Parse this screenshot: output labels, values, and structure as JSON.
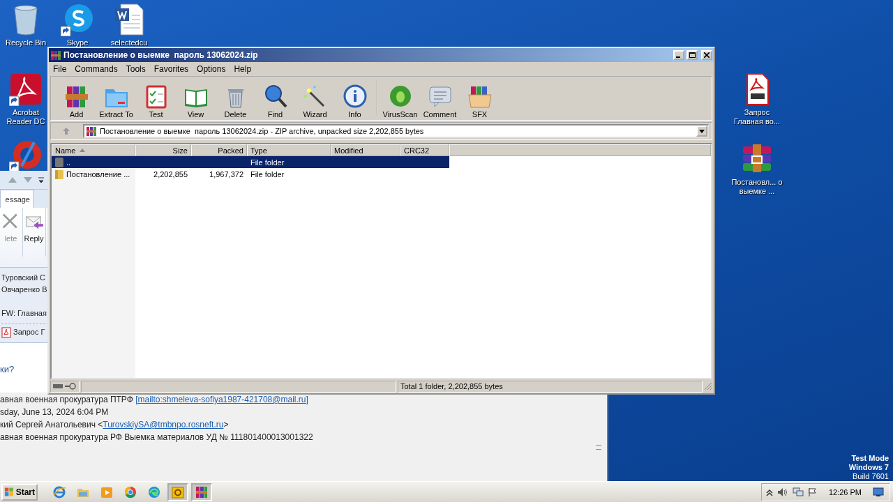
{
  "desktop": {
    "icons": [
      {
        "kind": "recycle",
        "label": "Recycle Bin",
        "shortcut": false
      },
      {
        "kind": "skype",
        "label": "Skype",
        "shortcut": true
      },
      {
        "kind": "word",
        "label": "selectedcu",
        "shortcut": false
      },
      {
        "kind": "acrobat",
        "label": "Acrobat Reader DC",
        "shortcut": true
      },
      {
        "kind": "ccleaner",
        "shortcut": true
      },
      {
        "kind": "pdf",
        "label": "Запрос Главная во...",
        "shortcut": false
      },
      {
        "kind": "rar",
        "label": "Постановл... о выемке  ...",
        "shortcut": false
      }
    ],
    "watermark_lines": [
      "Test Mode",
      "Windows 7",
      "Build 7601"
    ]
  },
  "mail_window": {
    "tabs": [
      {
        "label": "essage",
        "selected": true
      }
    ],
    "ribbon_buttons": [
      {
        "kind": "delete",
        "label": "lete",
        "disabled": true
      },
      {
        "kind": "reply",
        "label": "Reply",
        "disabled": false
      }
    ],
    "recipients": [
      "Туровский С",
      "Овчаренко В"
    ],
    "subject": "FW: Главная",
    "attachment": "Запрос Г",
    "body_text": "ки?",
    "header_lines": [
      {
        "text": "авная военная прокуратура ПТРФ ",
        "link": "[mailto:shmeleva-sofiya1987-421708@mail.ru]"
      },
      {
        "text": "sday, June 13, 2024 6:04 PM"
      },
      {
        "text": "кий Сергей Анатольевич <",
        "link": "TurovskiySA@tmbnpo.rosneft.ru",
        "after": ">"
      },
      {
        "text": "авная военная прокуратура РФ Выемка материалов УД № 111801400013001322"
      }
    ]
  },
  "archiver": {
    "title": "Постановление о выемке  пароль 13062024.zip",
    "menu": [
      "File",
      "Commands",
      "Tools",
      "Favorites",
      "Options",
      "Help"
    ],
    "toolbar": [
      {
        "kind": "add",
        "label": "Add"
      },
      {
        "kind": "extract",
        "label": "Extract To"
      },
      {
        "kind": "test",
        "label": "Test"
      },
      {
        "kind": "view",
        "label": "View"
      },
      {
        "kind": "delete",
        "label": "Delete"
      },
      {
        "kind": "find",
        "label": "Find"
      },
      {
        "kind": "wizard",
        "label": "Wizard"
      },
      {
        "kind": "info",
        "label": "Info"
      },
      {
        "kind": "virus",
        "label": "VirusScan"
      },
      {
        "kind": "comment",
        "label": "Comment"
      },
      {
        "kind": "sfx",
        "label": "SFX"
      }
    ],
    "address": "Постановление о выемке  пароль 13062024.zip - ZIP archive, unpacked size 2,202,855 bytes",
    "columns": [
      {
        "label": "Name",
        "sorted": true
      },
      {
        "label": "Size",
        "sorted": false
      },
      {
        "label": "Packed",
        "sorted": false
      },
      {
        "label": "Type",
        "sorted": false
      },
      {
        "label": "Modified",
        "sorted": false
      },
      {
        "label": "CRC32",
        "sorted": false
      }
    ],
    "rows": [
      {
        "kind": "up",
        "name": "..",
        "type": "File folder",
        "selected": true
      },
      {
        "kind": "folder",
        "name": "Постановление ...",
        "size": "2,202,855",
        "packed": "1,967,372",
        "type": "File folder",
        "selected": false
      }
    ],
    "status": "Total 1 folder, 2,202,855 bytes"
  },
  "taskbar": {
    "start": "Start",
    "apps": [
      {
        "kind": "ie",
        "active": false
      },
      {
        "kind": "explorer",
        "active": false
      },
      {
        "kind": "media",
        "active": false
      },
      {
        "kind": "chrome",
        "active": false
      },
      {
        "kind": "edge",
        "active": false
      },
      {
        "kind": "outlook",
        "active": true
      },
      {
        "kind": "winrar",
        "active": true
      }
    ],
    "time": "12:26 PM"
  }
}
